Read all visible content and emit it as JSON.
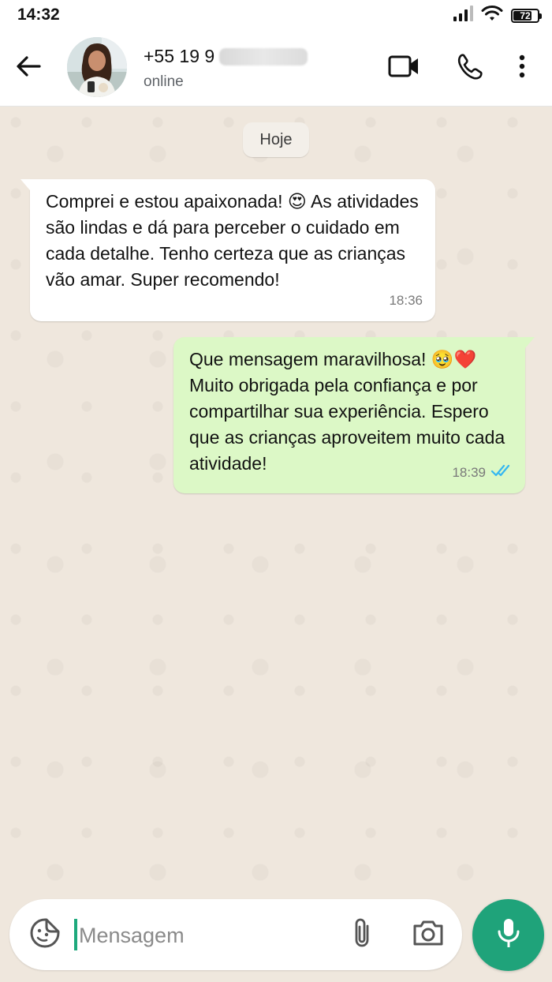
{
  "status_bar": {
    "time": "14:32",
    "battery": "72"
  },
  "header": {
    "contact_name": "+55 19 9",
    "contact_status": "online",
    "icons": [
      "back-arrow-icon",
      "video-call-icon",
      "phone-call-icon",
      "more-vert-icon"
    ]
  },
  "chat": {
    "date_chip": "Hoje",
    "messages": [
      {
        "direction": "incoming",
        "text": "Comprei e estou apaixonada! 😍 As atividades são lindas e dá para perceber o cuidado em cada detalhe. Tenho certeza que as crianças vão amar. Super recomendo!",
        "time": "18:36"
      },
      {
        "direction": "outgoing",
        "text": "Que mensagem maravilhosa! 🥹❤️ Muito obrigada pela confiança e por compartilhar sua experiência. Espero que as crianças aproveitem muito cada atividade!",
        "time": "18:39",
        "read_receipt": "double-check-icon"
      }
    ]
  },
  "composer": {
    "placeholder": "Mensagem",
    "icons": [
      "emoji-sticker-icon",
      "paperclip-icon",
      "camera-icon",
      "microphone-icon"
    ]
  },
  "colors": {
    "accent": "#1fa37a",
    "incoming_bubble": "#ffffff",
    "outgoing_bubble": "#dcf8c6",
    "read_ticks": "#34b7f1",
    "chat_background": "#efe7dd"
  }
}
